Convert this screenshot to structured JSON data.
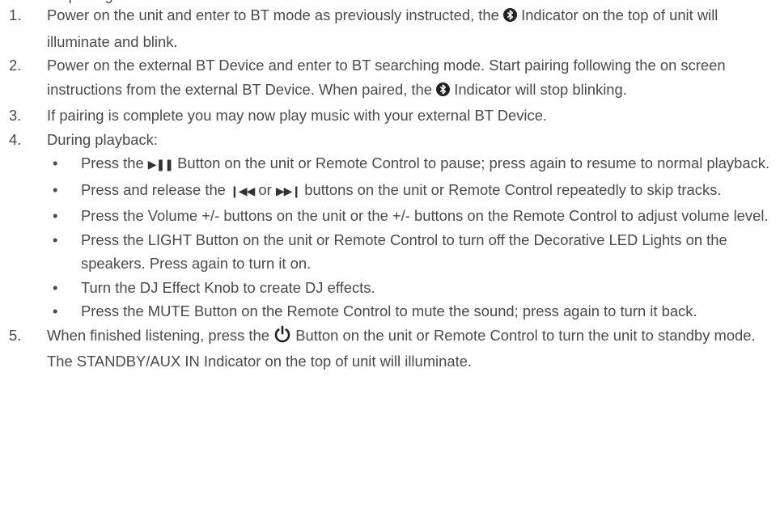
{
  "clipped_line": "for pairing with external BT Device.",
  "steps": [
    {
      "num": "1.",
      "a": "Power on the unit and enter to BT mode as previously instructed, the ",
      "b": " Indicator on the top of unit will illuminate and blink."
    },
    {
      "num": "2.",
      "a": "Power on the external BT Device and enter to BT searching mode. Start pairing following the on screen instructions from the external BT Device. When paired, the ",
      "b": " Indicator will stop blinking."
    },
    {
      "num": "3.",
      "a": "If pairing is complete you may now play music with your external BT Device."
    },
    {
      "num": "4.",
      "a": "During playback:"
    },
    {
      "num": "5.",
      "a": "When finished listening, press the ",
      "b": " Button on the unit or Remote Control to turn the unit to standby mode. The STANDBY/AUX IN Indicator on the top of unit will illuminate."
    }
  ],
  "bullet_char": "•",
  "play_pause_glyph": "▶❚❚",
  "prev_glyph": "❙◀◀",
  "next_glyph": "▶▶❙",
  "sub": [
    {
      "a": "Press the ",
      "b": " Button on the unit or Remote Control to pause; press again to resume to normal playback."
    },
    {
      "a": "Press and release the ",
      "b": " or ",
      "c": " buttons on the unit or Remote Control repeatedly to skip tracks."
    },
    {
      "a": "Press the Volume +/- buttons on the unit or the +/- buttons on the Remote Control to adjust volume level."
    },
    {
      "a": "Press the LIGHT Button on the unit or Remote Control to turn off the Decorative LED Lights on the speakers. Press again to turn it on."
    },
    {
      "a": "Turn the DJ Effect Knob to create DJ effects."
    },
    {
      "a": "Press the MUTE Button on the Remote Control to mute the sound; press again to turn it back."
    }
  ],
  "icons": {
    "bluetooth": "bluetooth-icon",
    "power": "power-icon",
    "play_pause": "play-pause-icon",
    "previous": "previous-track-icon",
    "next": "next-track-icon"
  }
}
